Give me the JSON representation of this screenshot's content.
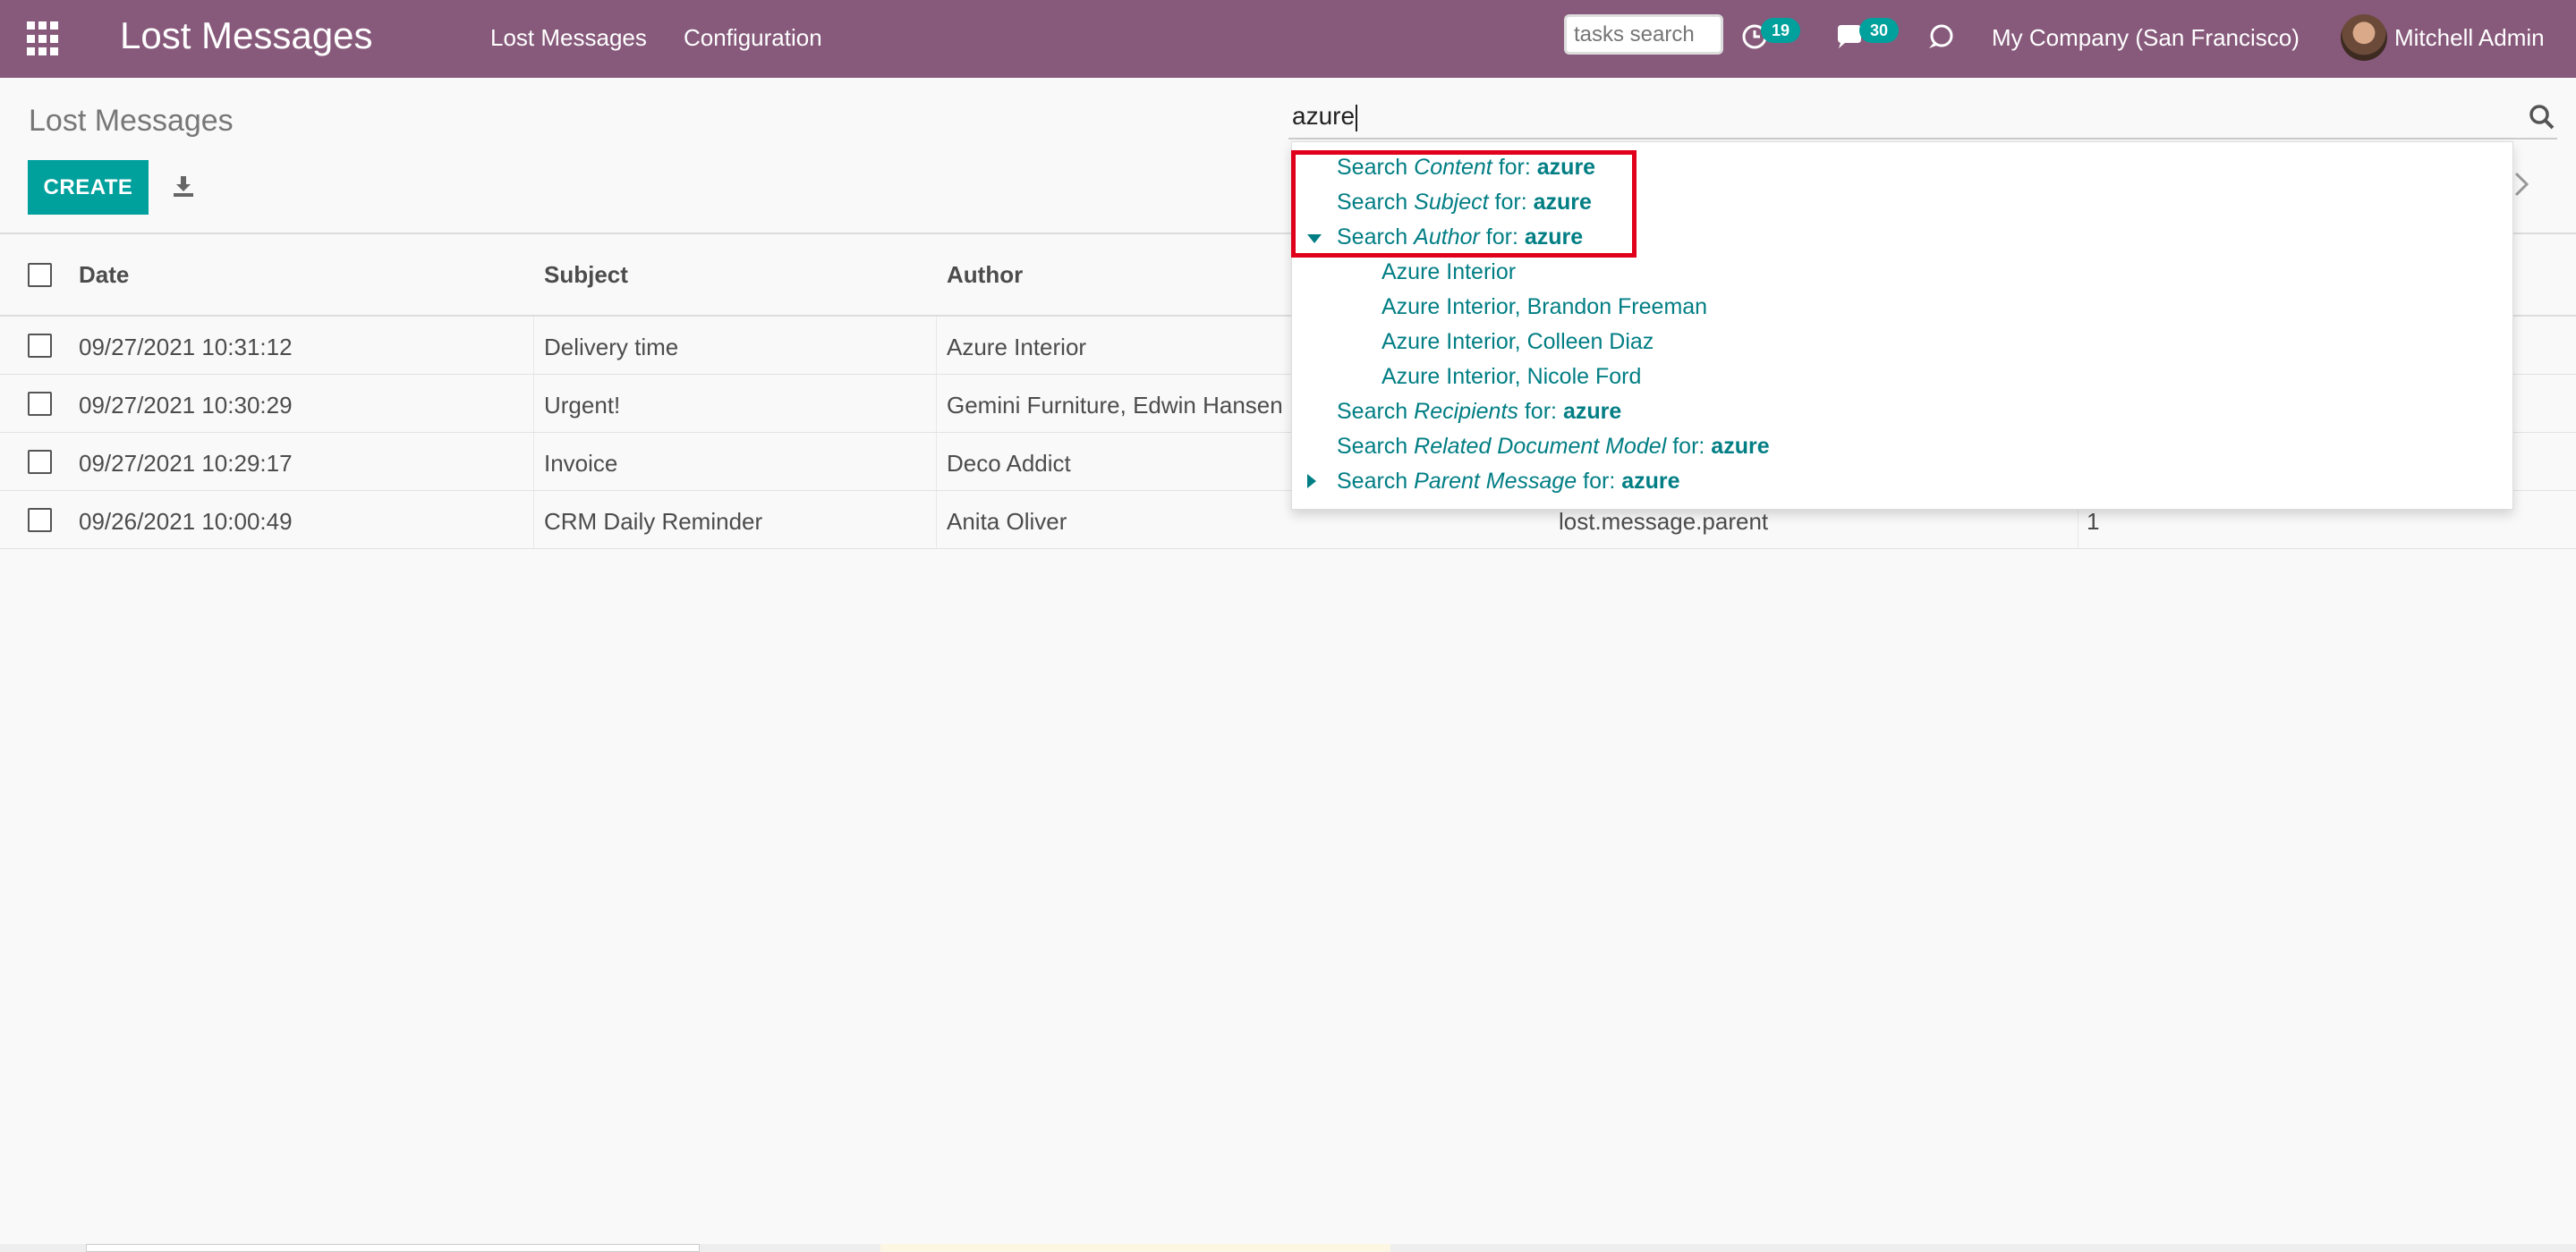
{
  "navbar": {
    "app_title": "Lost Messages",
    "menu": [
      "Lost Messages",
      "Configuration"
    ],
    "tasks_search_placeholder": "tasks search",
    "activity_count": "19",
    "message_count": "30",
    "company": "My Company (San Francisco)",
    "user": "Mitchell Admin",
    "bg_color": "#875a7b"
  },
  "control_panel": {
    "breadcrumb": "Lost Messages",
    "create_label": "CREATE",
    "search_value": "azure"
  },
  "table": {
    "headers": [
      "Date",
      "Subject",
      "Author"
    ],
    "rows": [
      {
        "date": "09/27/2021 10:31:12",
        "subject": "Delivery time",
        "author": "Azure Interior"
      },
      {
        "date": "09/27/2021 10:30:29",
        "subject": "Urgent!",
        "author": "Gemini Furniture, Edwin Hansen"
      },
      {
        "date": "09/27/2021 10:29:17",
        "subject": "Invoice",
        "author": "Deco Addict"
      },
      {
        "date": "09/26/2021 10:00:49",
        "subject": "CRM Daily Reminder",
        "author": "Anita Oliver",
        "model": "lost.message.parent",
        "extra": "1"
      }
    ]
  },
  "autocomplete": {
    "prefix": "Search",
    "for_text": "for:",
    "query": "azure",
    "items": [
      {
        "field": "Content"
      },
      {
        "field": "Subject"
      },
      {
        "field": "Author",
        "expanded": true
      },
      {
        "field": "Recipients"
      },
      {
        "field": "Related Document Model"
      },
      {
        "field": "Parent Message",
        "collapsed": true
      }
    ],
    "author_suggestions": [
      "Azure Interior",
      "Azure Interior, Brandon Freeman",
      "Azure Interior, Colleen Diaz",
      "Azure Interior, Nicole Ford"
    ]
  },
  "colors": {
    "accent": "#00a09d",
    "link": "#017e84",
    "highlight": "#e0001b"
  }
}
